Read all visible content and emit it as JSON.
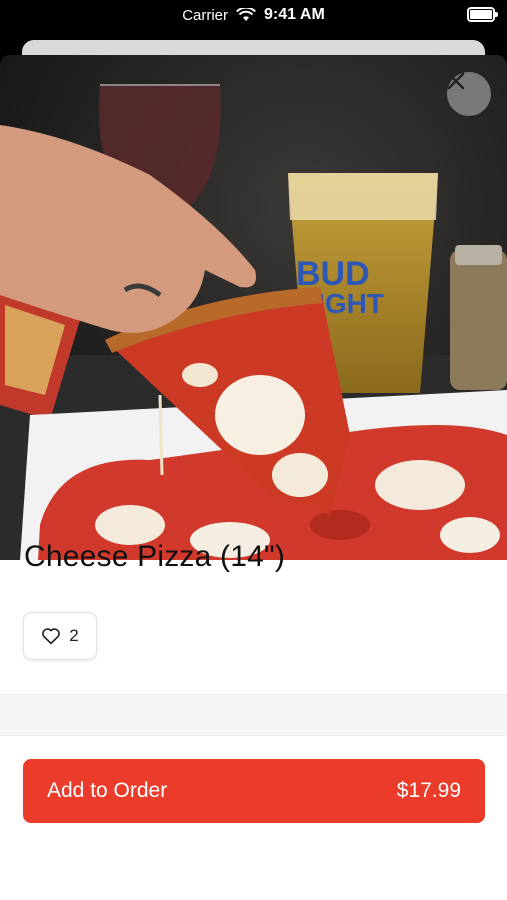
{
  "status_bar": {
    "carrier": "Carrier",
    "time": "9:41 AM"
  },
  "item": {
    "title": "Cheese Pizza (14\")",
    "likes": "2",
    "image_icon": "pizza-photo"
  },
  "actions": {
    "add_label": "Add to Order",
    "price": "$17.99"
  },
  "colors": {
    "accent": "#eb3b2b",
    "close_bg": "#969696"
  }
}
